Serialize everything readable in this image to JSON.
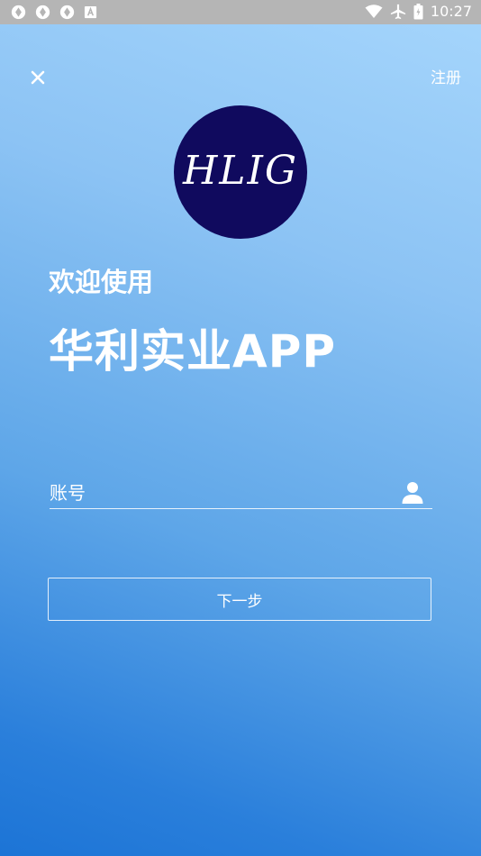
{
  "status_bar": {
    "time": "10:27",
    "left_icons": [
      "aperture-icon",
      "aperture-icon",
      "aperture-icon",
      "a-box-icon"
    ],
    "right_icons": [
      "wifi-icon",
      "airplane-icon",
      "battery-icon"
    ]
  },
  "header": {
    "close_icon": "close-icon",
    "register_label": "注册"
  },
  "logo": {
    "text": "HLIG",
    "bg_color": "#100a5e"
  },
  "welcome": {
    "line1": "欢迎使用",
    "line2": "华利实业APP"
  },
  "form": {
    "account_placeholder": "账号",
    "account_value": "",
    "account_icon": "user-icon",
    "next_label": "下一步"
  },
  "colors": {
    "gradient_top": "#a6d6fc",
    "gradient_bottom": "#1c74d6",
    "status_bar": "#b5b5b5"
  }
}
